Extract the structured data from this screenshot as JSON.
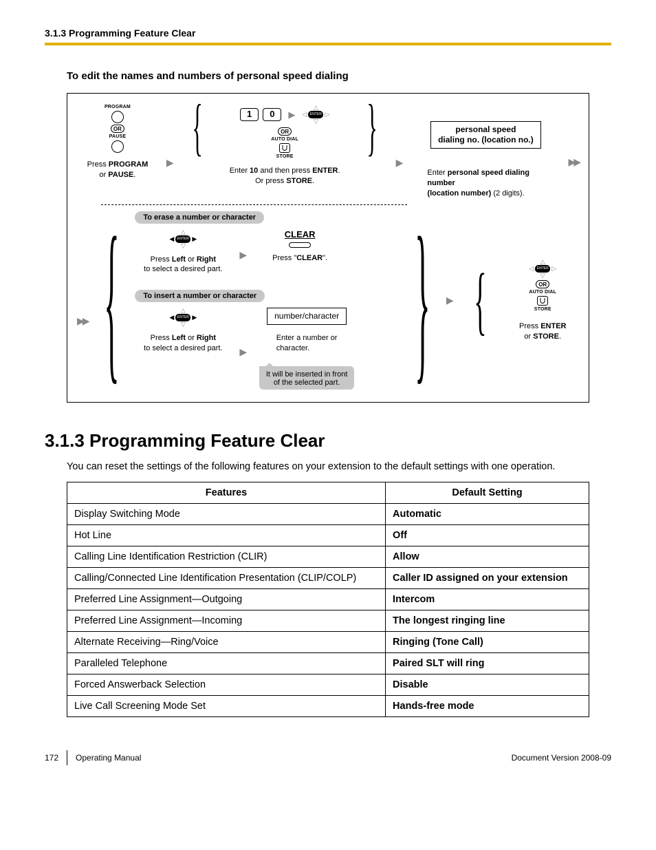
{
  "header_breadcrumb": "3.1.3 Programming Feature Clear",
  "edit_heading": "To edit the names and numbers of personal speed dialing",
  "flow": {
    "r1": {
      "program_label": "PROGRAM",
      "or": "OR",
      "pause_label": "PAUSE",
      "cap1a": "Press ",
      "cap1b": "PROGRAM",
      "cap1c": "or ",
      "cap1d": "PAUSE",
      "cap1e": ".",
      "key1": "1",
      "key0": "0",
      "auto_dial": "AUTO DIAL",
      "store": "STORE",
      "cap2a": "Enter ",
      "cap2b": "10",
      "cap2c": " and then press ",
      "cap2d": "ENTER",
      "cap2e": ".",
      "cap2f": "Or press ",
      "cap2g": "STORE",
      "cap2h": ".",
      "box3a": "personal speed",
      "box3b": "dialing no. (location no.)",
      "cap3a": "Enter ",
      "cap3b": "personal speed dialing number",
      "cap3c": "(location number)",
      "cap3d": " (2 digits)."
    },
    "r2": {
      "erase_head": "To erase a number or character",
      "cap_lrA": "Press ",
      "cap_lrB": "Left",
      "cap_lrC": " or ",
      "cap_lrD": "Right",
      "cap_lrE": "to select a desired part.",
      "clear_label": "CLEAR",
      "cap_clearA": "Press \"",
      "cap_clearB": "CLEAR",
      "cap_clearC": "\".",
      "insert_head": "To insert a number or character",
      "numchar_box": "number/character",
      "cap_nc1": "Enter a number or",
      "cap_nc2": "character.",
      "note1": "It will be inserted in front",
      "note2": "of the selected part.",
      "cap_es1": "Press ",
      "cap_es2": "ENTER",
      "cap_es3": "or ",
      "cap_es4": "STORE",
      "cap_es5": "."
    }
  },
  "section_title": "3.1.3  Programming Feature Clear",
  "section_intro": "You can reset the settings of the following features on your extension to the default settings with one operation.",
  "table": {
    "h1": "Features",
    "h2": "Default Setting",
    "rows": [
      {
        "f": "Display Switching Mode",
        "d": "Automatic"
      },
      {
        "f": "Hot Line",
        "d": "Off"
      },
      {
        "f": "Calling Line Identification Restriction (CLIR)",
        "d": "Allow"
      },
      {
        "f": "Calling/Connected Line Identification Presentation (CLIP/COLP)",
        "d": "Caller ID assigned on your extension"
      },
      {
        "f": "Preferred Line Assignment—Outgoing",
        "d": "Intercom"
      },
      {
        "f": "Preferred Line Assignment—Incoming",
        "d": "The longest ringing line"
      },
      {
        "f": "Alternate Receiving—Ring/Voice",
        "d": "Ringing (Tone Call)"
      },
      {
        "f": "Paralleled Telephone",
        "d": "Paired SLT will ring"
      },
      {
        "f": "Forced Answerback Selection",
        "d": "Disable"
      },
      {
        "f": "Live Call Screening Mode Set",
        "d": "Hands-free mode"
      }
    ]
  },
  "footer": {
    "page": "172",
    "manual": "Operating Manual",
    "docver": "Document Version  2008-09"
  }
}
